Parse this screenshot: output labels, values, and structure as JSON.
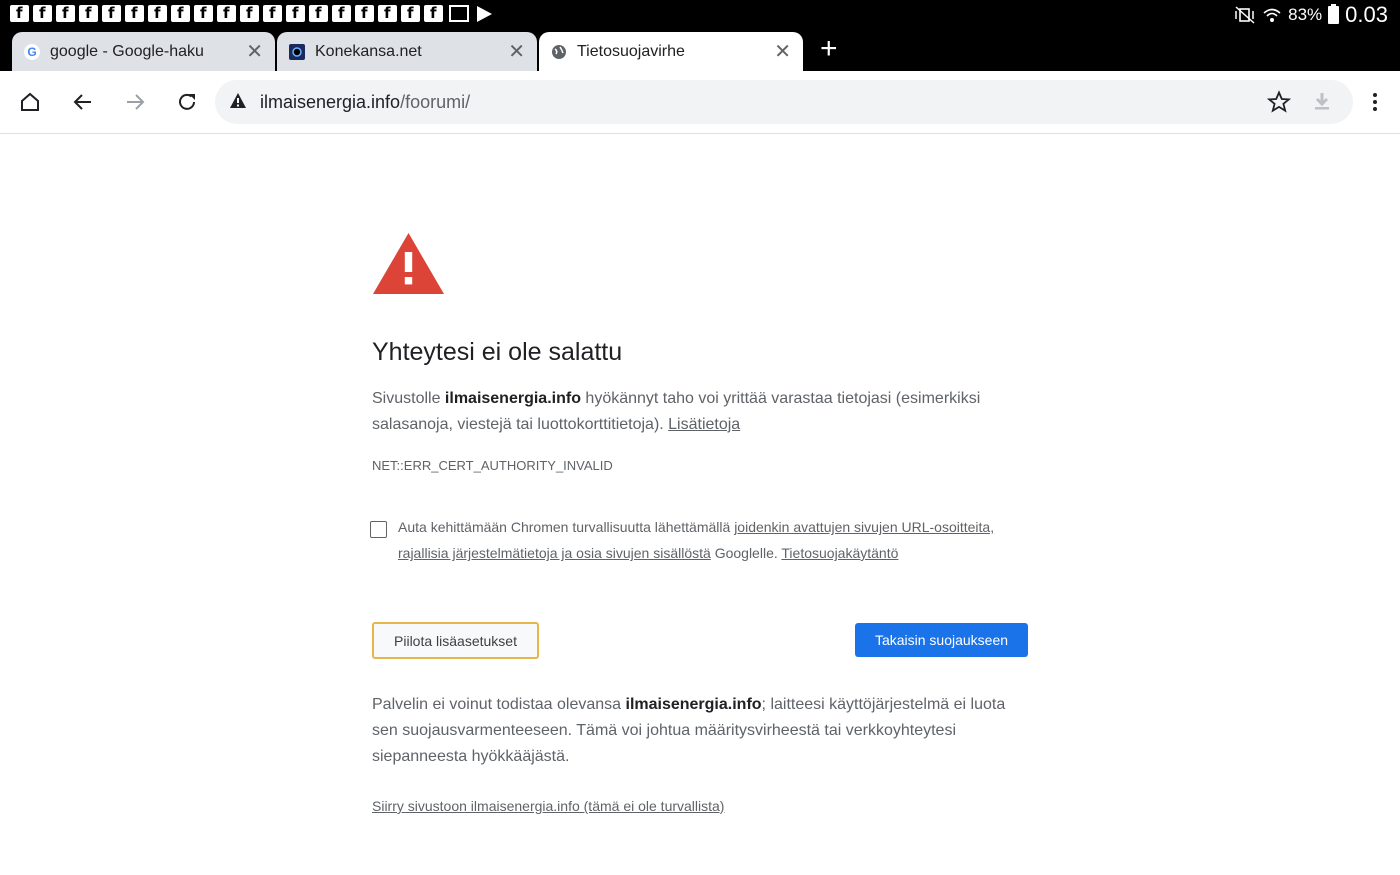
{
  "statusbar": {
    "battery": "83%",
    "clock": "0.03",
    "notification_icons": [
      "facebook-icon",
      "facebook-icon",
      "facebook-icon",
      "facebook-icon",
      "facebook-icon",
      "facebook-icon",
      "facebook-icon",
      "facebook-icon",
      "facebook-icon",
      "facebook-icon",
      "facebook-icon",
      "facebook-icon",
      "facebook-icon",
      "facebook-icon",
      "facebook-icon",
      "facebook-icon",
      "facebook-icon",
      "facebook-icon",
      "facebook-icon",
      "gmail-icon",
      "play-store-icon"
    ]
  },
  "tabs": [
    {
      "title": "google - Google-haku",
      "favicon": "google-g-icon",
      "active": false
    },
    {
      "title": "Konekansa.net",
      "favicon": "konekansa-icon",
      "active": false
    },
    {
      "title": "Tietosuojavirhe",
      "favicon": "globe-icon",
      "active": true
    }
  ],
  "toolbar": {
    "url_host": "ilmaisenergia.info",
    "url_path": "/foorumi/"
  },
  "page": {
    "heading": "Yhteytesi ei ole salattu",
    "p1_before": "Sivustolle ",
    "p1_host": "ilmaisenergia.info",
    "p1_after": " hyökännyt taho voi yrittää varastaa tietojasi (esimerkiksi salasanoja, viestejä tai luottokorttitietoja). ",
    "learn_more": "Lisätietoja",
    "error_code": "NET::ERR_CERT_AUTHORITY_INVALID",
    "checkbox_before": "Auta kehittämään Chromen turvallisuutta lähettämällä ",
    "checkbox_link1": "joidenkin avattujen sivujen URL-osoitteita, rajallisia järjestelmätietoja ja osia sivujen sisällöstä",
    "checkbox_middle": " Googlelle. ",
    "checkbox_link2": "Tietosuojakäytäntö",
    "hide_advanced": "Piilota lisäasetukset",
    "back_to_safety": "Takaisin suojaukseen",
    "p2_before": "Palvelin ei voinut todistaa olevansa ",
    "p2_host": "ilmaisenergia.info",
    "p2_after": "; laitteesi käyttöjärjestelmä ei luota sen suojausvarmenteeseen. Tämä voi johtua määritysvirheestä tai verkkoyhteytesi siepanneesta hyökkääjästä.",
    "proceed_link": "Siirry sivustoon ilmaisenergia.info (tämä ei ole turvallista)"
  },
  "colors": {
    "warning_red": "#db4437",
    "primary_button": "#1a73e8",
    "focus_outline": "#e6b64a"
  }
}
